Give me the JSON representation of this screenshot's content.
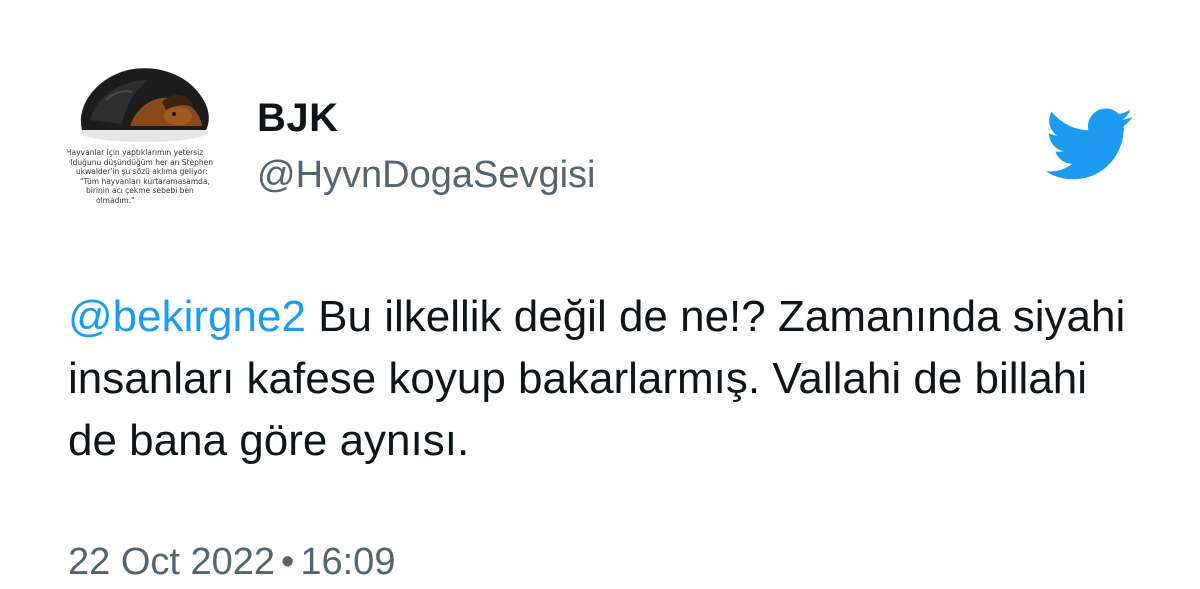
{
  "author": {
    "display_name": "BJK",
    "handle": "@HyvnDogaSevgisi",
    "avatar_caption": [
      "Hayvanlar için yaptıklarımın yetersiz",
      "olduğunu düşündüğüm her an Stephen",
      "ukwalder'in şu sözü aklıma geliyor:",
      "\"Tüm hayvanları kurtaramasamda,",
      "birinin acı çekme sebebi ben",
      "olmadım.\""
    ]
  },
  "tweet": {
    "mention": "@bekirgne2",
    "text": " Bu ilkellik değil de ne!? Zamanında siyahi insanları kafese koyup bakarlarmış. Vallahi de billahi de bana göre aynısı.",
    "date": "22 Oct 2022",
    "separator": "•",
    "time": "16:09"
  },
  "brand": {
    "logo_icon": "twitter-bird-icon",
    "accent_color": "#1d9bf0"
  }
}
